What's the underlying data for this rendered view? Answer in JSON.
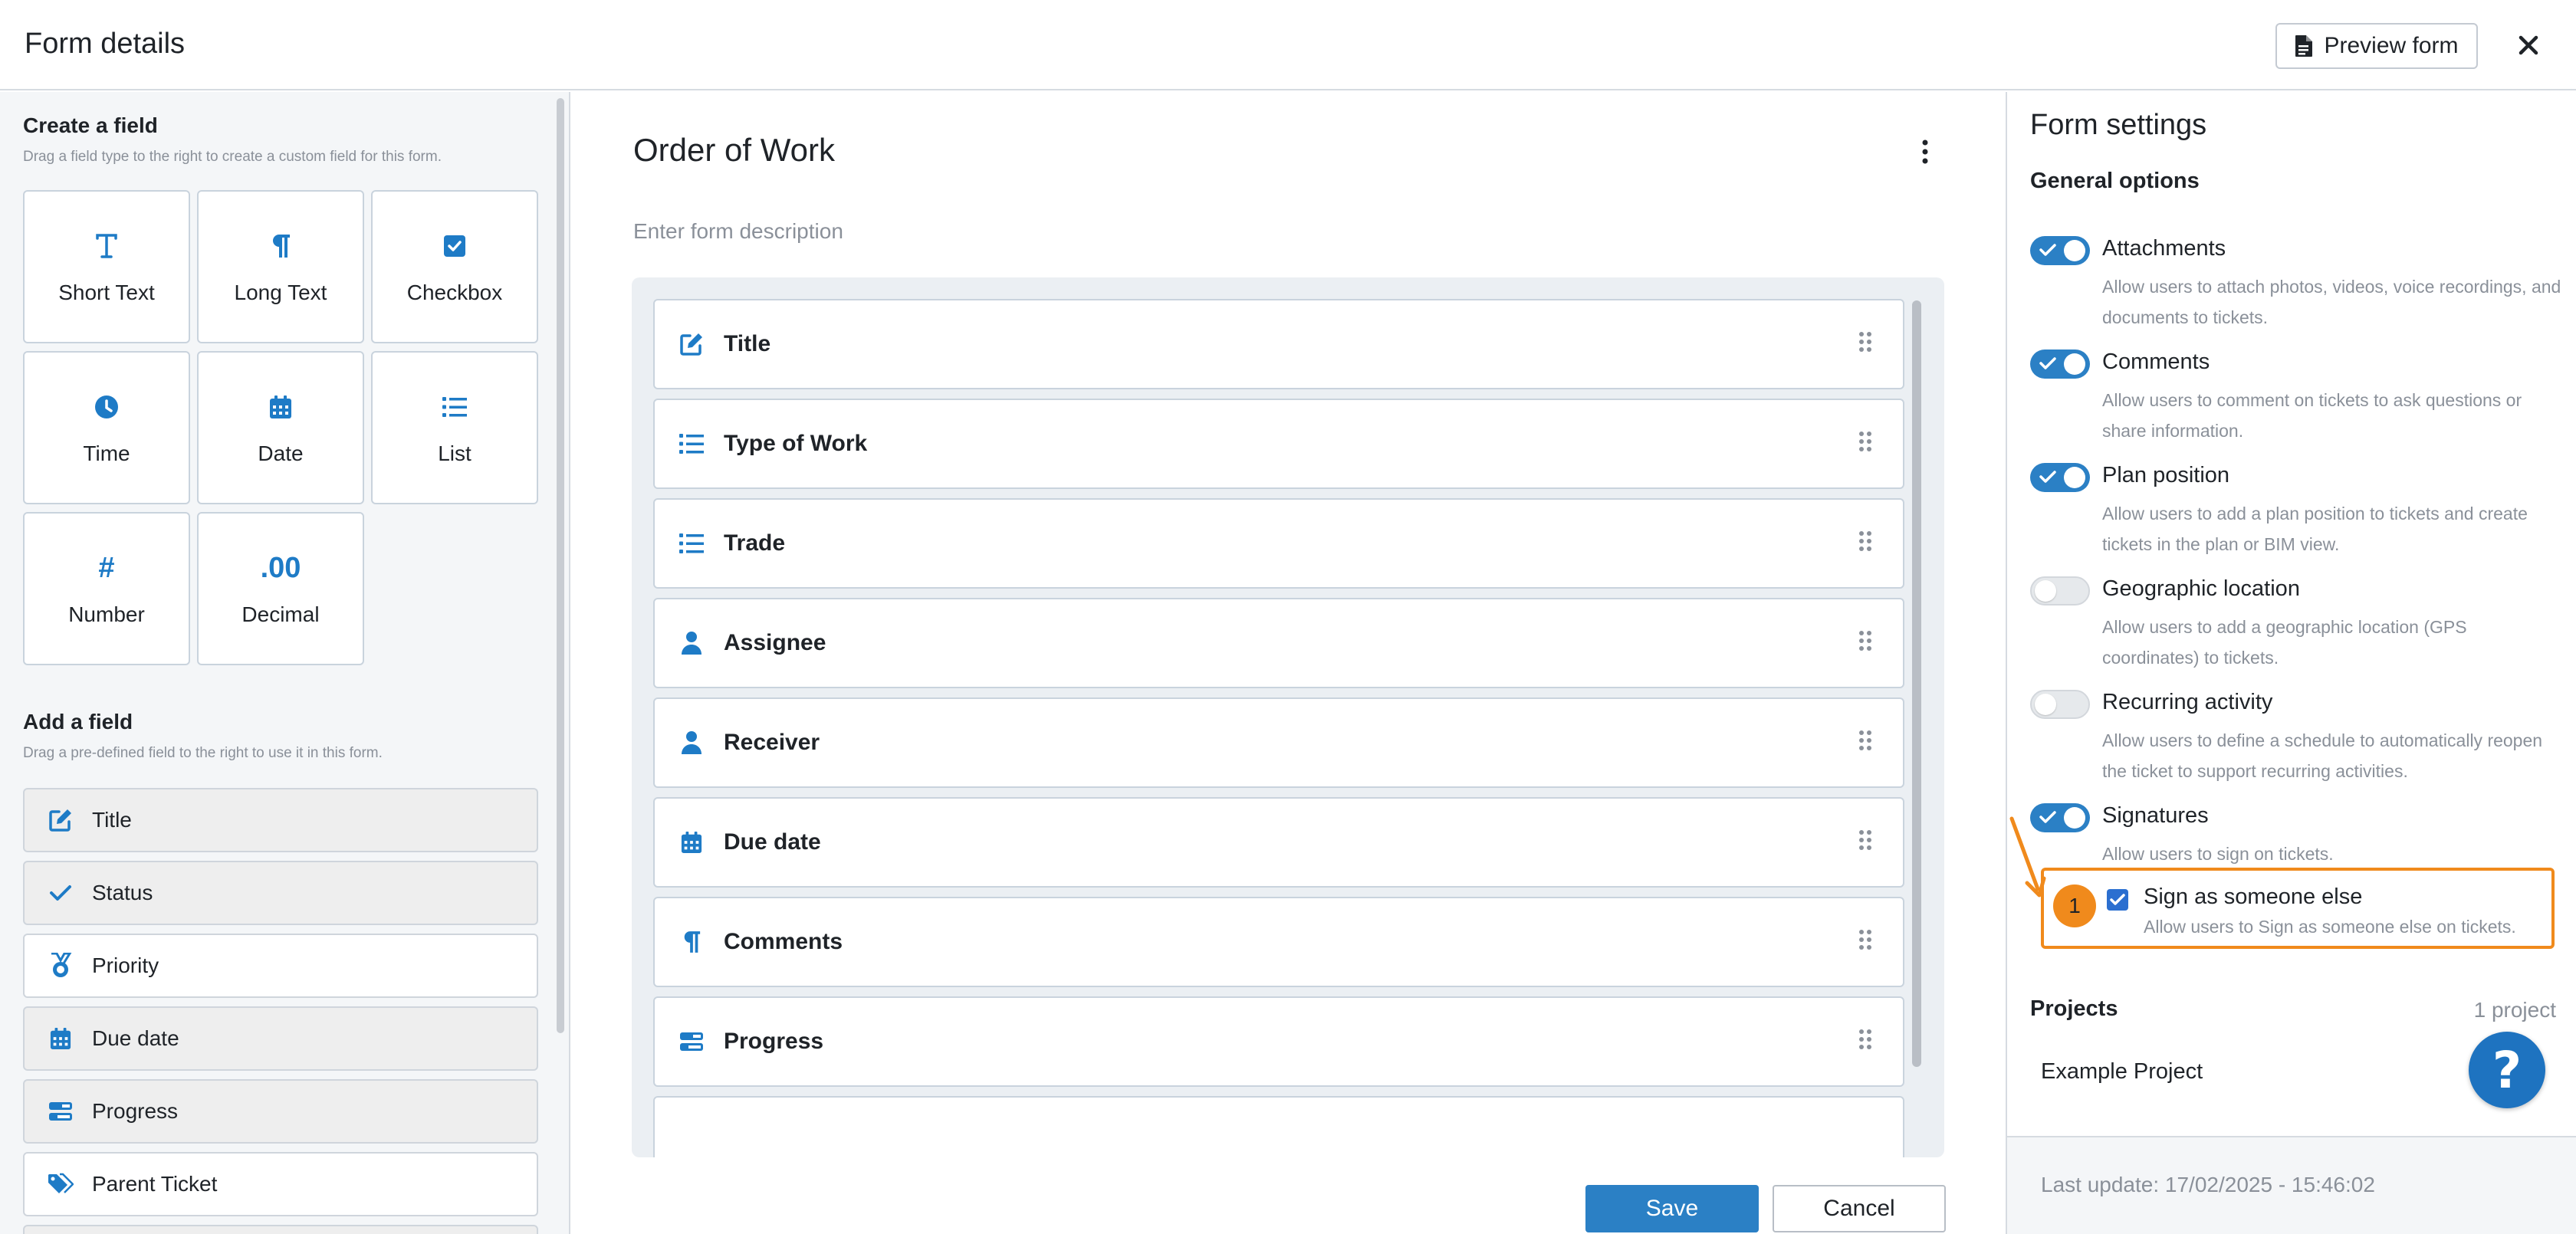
{
  "header": {
    "title": "Form details",
    "preview_label": "Preview form"
  },
  "left_panel": {
    "create_title": "Create a field",
    "create_hint": "Drag a field type to the right to create a custom field for this form.",
    "field_types": [
      {
        "label": "Short Text",
        "icon": "text-t-icon"
      },
      {
        "label": "Long Text",
        "icon": "paragraph-icon"
      },
      {
        "label": "Checkbox",
        "icon": "checkbox-icon"
      },
      {
        "label": "Time",
        "icon": "clock-icon"
      },
      {
        "label": "Date",
        "icon": "calendar-icon"
      },
      {
        "label": "List",
        "icon": "list-icon"
      },
      {
        "label": "Number",
        "icon": "hash-icon",
        "glyph": "#"
      },
      {
        "label": "Decimal",
        "icon": "decimal-icon",
        "glyph": ".00"
      }
    ],
    "add_title": "Add a field",
    "add_hint": "Drag a pre-defined field to the right to use it in this form.",
    "predefined_fields": [
      {
        "label": "Title",
        "icon": "edit-icon",
        "state": "used"
      },
      {
        "label": "Status",
        "icon": "check-icon",
        "state": "used"
      },
      {
        "label": "Priority",
        "icon": "medal-icon",
        "state": "available"
      },
      {
        "label": "Due date",
        "icon": "calendar-icon",
        "state": "used"
      },
      {
        "label": "Progress",
        "icon": "progress-icon",
        "state": "used"
      },
      {
        "label": "Parent Ticket",
        "icon": "tags-icon",
        "state": "available"
      }
    ]
  },
  "form": {
    "title": "Order of Work",
    "description_placeholder": "Enter form description",
    "fields": [
      {
        "label": "Title",
        "icon": "edit-icon"
      },
      {
        "label": "Type of Work",
        "icon": "list-icon"
      },
      {
        "label": "Trade",
        "icon": "list-icon"
      },
      {
        "label": "Assignee",
        "icon": "person-icon"
      },
      {
        "label": "Receiver",
        "icon": "person-icon"
      },
      {
        "label": "Due date",
        "icon": "calendar-icon"
      },
      {
        "label": "Comments",
        "icon": "paragraph-icon"
      },
      {
        "label": "Progress",
        "icon": "progress-icon"
      }
    ],
    "save_label": "Save",
    "cancel_label": "Cancel"
  },
  "settings": {
    "title": "Form settings",
    "general_title": "General options",
    "options": [
      {
        "label": "Attachments",
        "desc": "Allow users to attach photos, videos, voice recordings, and documents to tickets.",
        "enabled": true
      },
      {
        "label": "Comments",
        "desc": "Allow users to comment on tickets to ask questions or share information.",
        "enabled": true
      },
      {
        "label": "Plan position",
        "desc": "Allow users to add a plan position to tickets and create tickets in the plan or BIM view.",
        "enabled": true
      },
      {
        "label": "Geographic location",
        "desc": "Allow users to add a geographic location (GPS coordinates) to tickets.",
        "enabled": false
      },
      {
        "label": "Recurring activity",
        "desc": "Allow users to define a schedule to automatically reopen the ticket to support recurring activities.",
        "enabled": false
      },
      {
        "label": "Signatures",
        "desc": "Allow users to sign on tickets.",
        "enabled": true
      }
    ],
    "sign_as": {
      "badge": "1",
      "label": "Sign as someone else",
      "desc": "Allow users to Sign as someone else on tickets.",
      "checked": true
    },
    "projects_title": "Projects",
    "projects_count": "1 project",
    "project_name": "Example Project",
    "last_update": "Last update: 17/02/2025 - 15:46:02"
  },
  "colors": {
    "accent": "#2b80c5",
    "icon_blue": "#1e7bc6",
    "highlight_orange": "#f08a1c"
  }
}
